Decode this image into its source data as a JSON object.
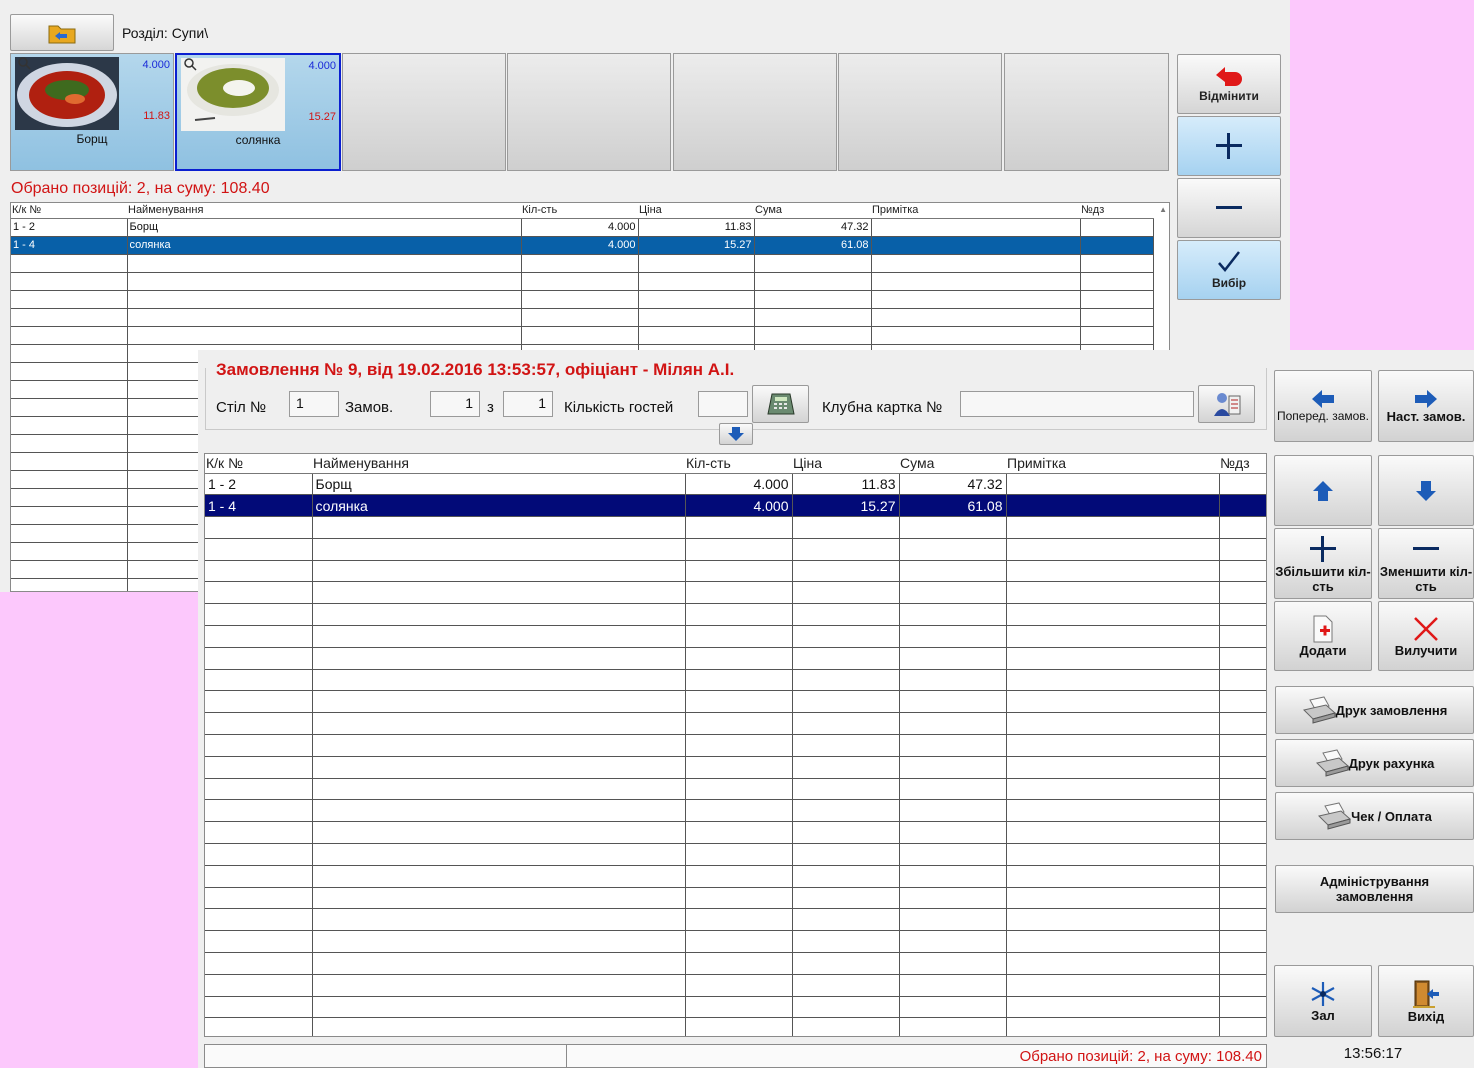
{
  "menu": {
    "section_label": "Розділ: Супи\\",
    "dishes": [
      {
        "name": "Борщ",
        "qty": "4.000",
        "price": "11.83"
      },
      {
        "name": "солянка",
        "qty": "4.000",
        "price": "15.27"
      }
    ],
    "side_buttons": {
      "cancel": "Відмінити",
      "choose": "Вибір"
    },
    "summary": "Обрано позицій: 2, на суму: 108.40",
    "grid": {
      "headers": [
        "К/к №",
        "Найменування",
        "Кіл-сть",
        "Ціна",
        "Сума",
        "Примітка",
        "№дз"
      ],
      "rows": [
        [
          "1 - 2",
          "Борщ",
          "4.000",
          "11.83",
          "47.32",
          "",
          ""
        ],
        [
          "1 - 4",
          "солянка",
          "4.000",
          "15.27",
          "61.08",
          "",
          ""
        ]
      ]
    }
  },
  "order": {
    "title": "Замовлення № 9, від 19.02.2016 13:53:57, офіціант - Мілян А.І.",
    "table_label": "Стіл №",
    "table_value": "1",
    "order_label": "Замов.",
    "order_value": "1",
    "of_label": "з",
    "of_value": "1",
    "guests_label": "Кількість гостей",
    "guests_value": "",
    "club_card_label": "Клубна картка №",
    "club_card_value": "",
    "grid": {
      "headers": [
        "К/к №",
        "Найменування",
        "Кіл-сть",
        "Ціна",
        "Сума",
        "Примітка",
        "№дз"
      ],
      "rows": [
        [
          "1 - 2",
          "Борщ",
          "4.000",
          "11.83",
          "47.32",
          "",
          ""
        ],
        [
          "1 - 4",
          "солянка",
          "4.000",
          "15.27",
          "61.08",
          "",
          ""
        ]
      ]
    },
    "status_summary": "Обрано позицій: 2, на суму: 108.40",
    "clock": "13:56:17"
  },
  "buttons": {
    "prev_order": "Поперед. замов.",
    "next_order": "Наст. замов.",
    "increase_qty": "Збільшити кіл-сть",
    "decrease_qty": "Зменшити кіл-сть",
    "add": "Додати",
    "remove": "Вилучити",
    "print_order": "Друк замовлення",
    "print_bill": "Друк рахунка",
    "receipt_payment": "Чек / Оплата",
    "admin_order": "Адміністрування замовлення",
    "hall": "Зал",
    "exit": "Вихід"
  },
  "colors": {
    "background": "#fcc8fc",
    "accent_red": "#d11414",
    "selection_back": "#0860a8",
    "selection_front": "#020a78"
  }
}
